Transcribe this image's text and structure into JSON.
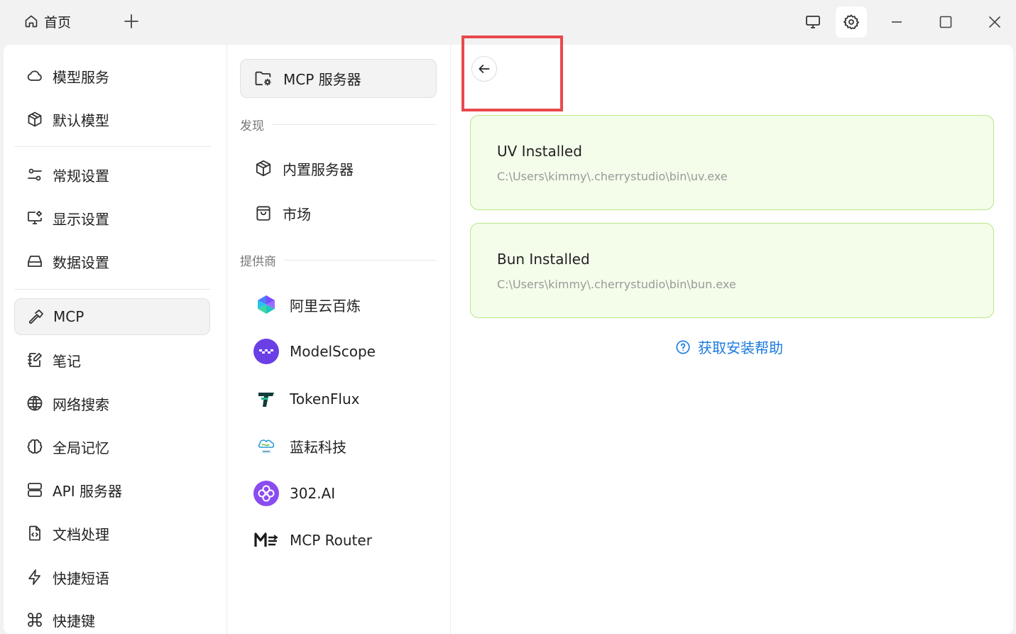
{
  "titlebar": {
    "home_tab_label": "首页",
    "icons": [
      "home-icon",
      "plus-icon",
      "monitor-icon",
      "gear-icon",
      "minimize-icon",
      "maximize-icon",
      "close-icon"
    ]
  },
  "sidebar": {
    "items": [
      {
        "label": "模型服务",
        "icon": "cloud-icon"
      },
      {
        "label": "默认模型",
        "icon": "cube-icon"
      },
      {
        "label": "常规设置",
        "icon": "sliders-icon"
      },
      {
        "label": "显示设置",
        "icon": "display-settings-icon"
      },
      {
        "label": "数据设置",
        "icon": "hard-drive-icon"
      },
      {
        "label": "MCP",
        "icon": "hammer-icon",
        "active": true
      },
      {
        "label": "笔记",
        "icon": "notebook-icon"
      },
      {
        "label": "网络搜索",
        "icon": "globe-icon"
      },
      {
        "label": "全局记忆",
        "icon": "brain-icon"
      },
      {
        "label": "API 服务器",
        "icon": "server-icon"
      },
      {
        "label": "文档处理",
        "icon": "file-code-icon"
      },
      {
        "label": "快捷短语",
        "icon": "zap-icon"
      },
      {
        "label": "快捷键",
        "icon": "command-icon"
      }
    ]
  },
  "mcp_panel": {
    "servers_button": "MCP 服务器",
    "discover_heading": "发现",
    "discover_items": [
      {
        "label": "内置服务器",
        "icon": "cube-icon"
      },
      {
        "label": "市场",
        "icon": "shopping-bag-icon"
      }
    ],
    "providers_heading": "提供商",
    "providers": [
      {
        "label": "阿里云百炼",
        "logo": "bailian-logo"
      },
      {
        "label": "ModelScope",
        "logo": "modelscope-logo"
      },
      {
        "label": "TokenFlux",
        "logo": "tokenflux-logo"
      },
      {
        "label": "蓝耘科技",
        "logo": "lanyun-logo"
      },
      {
        "label": "302.AI",
        "logo": "302ai-logo"
      },
      {
        "label": "MCP Router",
        "logo": "mcprouter-logo"
      }
    ]
  },
  "content": {
    "status_cards": [
      {
        "title": "UV Installed",
        "path": "C:\\Users\\kimmy\\.cherrystudio\\bin\\uv.exe"
      },
      {
        "title": "Bun Installed",
        "path": "C:\\Users\\kimmy\\.cherrystudio\\bin\\bun.exe"
      }
    ],
    "help_link": "获取安装帮助"
  },
  "colors": {
    "accent_link": "#1a7ae0",
    "success_bg": "#f4fdea",
    "success_border": "#b9e887",
    "highlight_box": "#e8494d"
  }
}
